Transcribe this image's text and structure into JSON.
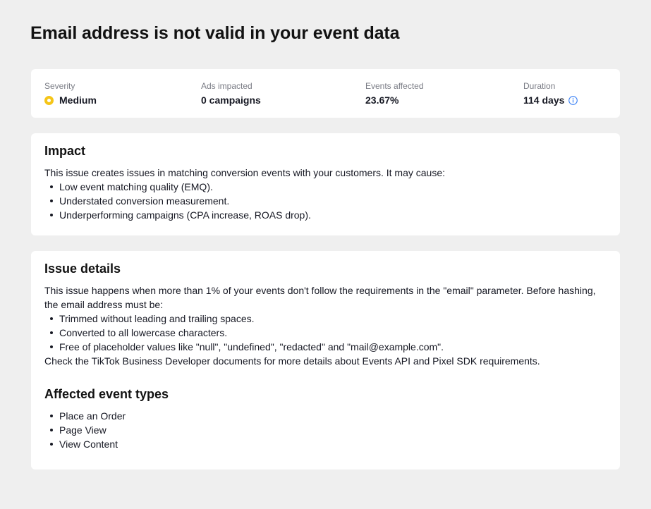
{
  "page": {
    "title": "Email address is not valid in your event data"
  },
  "summary": {
    "severity": {
      "label": "Severity",
      "value": "Medium",
      "color": "#f5c518"
    },
    "ads_impacted": {
      "label": "Ads impacted",
      "value": "0 campaigns"
    },
    "events_affected": {
      "label": "Events affected",
      "value": "23.67%"
    },
    "duration": {
      "label": "Duration",
      "value": "114 days",
      "icon": "info-icon",
      "icon_color": "#3b82f6"
    }
  },
  "impact": {
    "heading": "Impact",
    "intro": "This issue creates issues in matching conversion events with your customers. It may cause:",
    "bullets": [
      "Low event matching quality (EMQ).",
      "Understated conversion measurement.",
      "Underperforming campaigns (CPA increase, ROAS drop)."
    ]
  },
  "issue_details": {
    "heading": "Issue details",
    "intro": "This issue happens when more than 1% of your events don't follow the requirements in the \"email\" parameter. Before hashing, the email address must be:",
    "bullets": [
      "Trimmed without leading and trailing spaces.",
      "Converted to all lowercase characters.",
      "Free of placeholder values like \"null\", \"undefined\", \"redacted\" and \"mail@example.com\"."
    ],
    "outro": "Check the TikTok Business Developer documents for more details about Events API and Pixel SDK requirements."
  },
  "affected_event_types": {
    "heading": "Affected event types",
    "items": [
      "Place an Order",
      "Page View",
      "View Content"
    ]
  }
}
